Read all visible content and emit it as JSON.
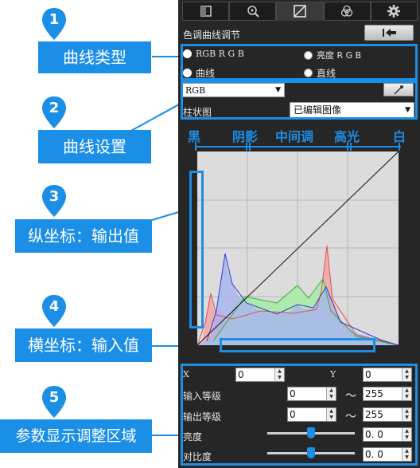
{
  "callouts": [
    {
      "num": "1",
      "label": "曲线类型"
    },
    {
      "num": "2",
      "label": "曲线设置"
    },
    {
      "num": "3",
      "label": "纵坐标：输出值"
    },
    {
      "num": "4",
      "label": "横坐标：输入值"
    },
    {
      "num": "5",
      "label": "参数显示调整区域"
    }
  ],
  "panel": {
    "title": "色调曲线调节",
    "undo_icon": "undo-arrow-icon",
    "tabs": [
      {
        "icon": "basic-image-icon"
      },
      {
        "icon": "detail-magnify-icon"
      },
      {
        "icon": "tone-curve-icon"
      },
      {
        "icon": "color-adjust-icon"
      },
      {
        "icon": "settings-gear-icon"
      }
    ],
    "curve_type": {
      "rgb_mode": "RGB R G B",
      "luminance_mode": "亮度 R G B",
      "curve_label": "曲线",
      "line_label": "直线"
    },
    "curve_settings": {
      "channel_value": "RGB",
      "histogram_label": "柱状图",
      "histogram_value": "已编辑图像"
    },
    "ranges": [
      "黑",
      "阴影",
      "中间调",
      "高光",
      "白"
    ],
    "params": {
      "x_label": "X",
      "x_value": "0",
      "y_label": "Y",
      "y_value": "0",
      "input_level_label": "输入等级",
      "input_min": "0",
      "input_max": "255",
      "output_level_label": "输出等级",
      "output_min": "0",
      "output_max": "255",
      "brightness_label": "亮度",
      "brightness_value": "0. 0",
      "contrast_label": "对比度",
      "contrast_value": "0. 0",
      "tilde": "～"
    }
  },
  "colors": {
    "accent": "#1b8ee6",
    "panel_bg": "#262626"
  }
}
